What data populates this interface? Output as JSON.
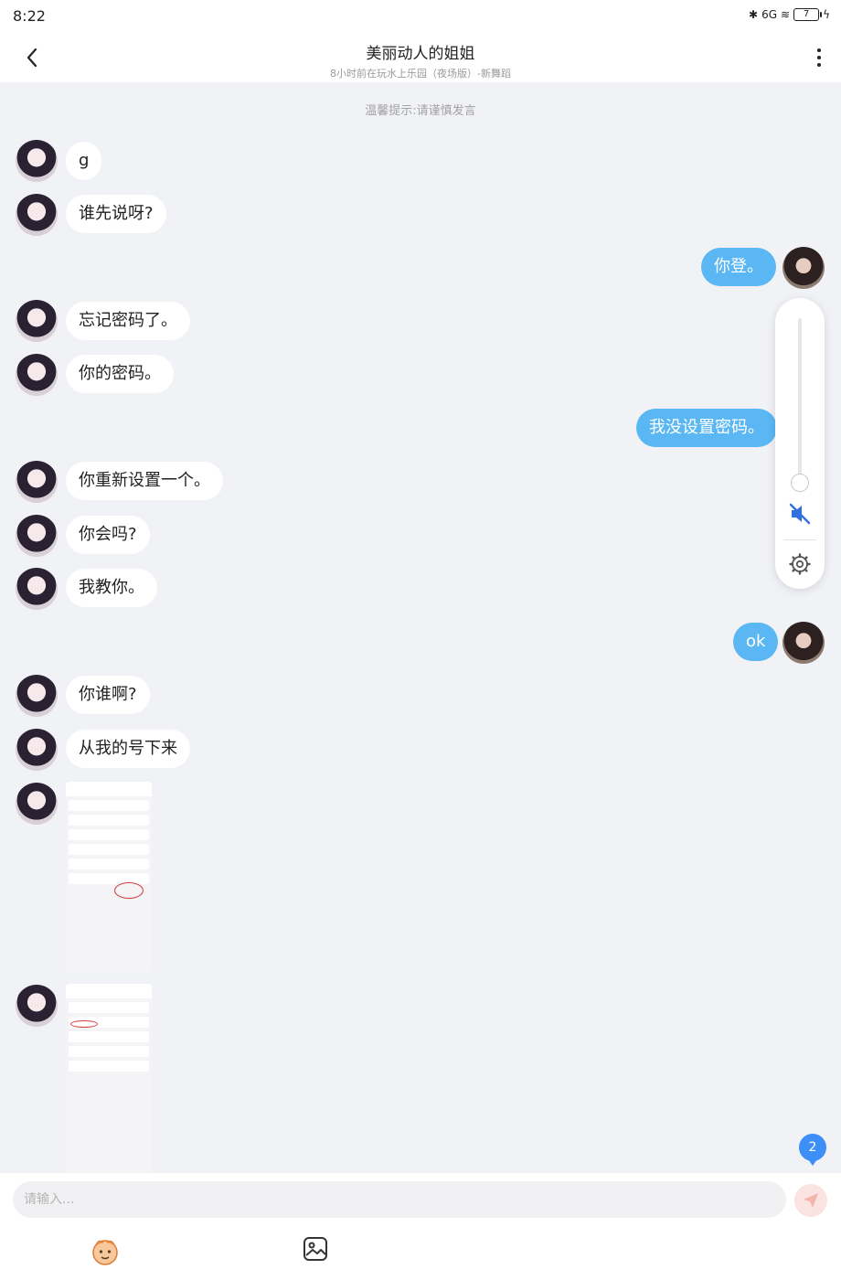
{
  "status_bar": {
    "time": "8:22",
    "signal": "6G",
    "battery": "7"
  },
  "header": {
    "title": "美丽动人的姐姐",
    "subtitle": "8小时前在玩水上乐园（夜场版）-新舞蹈"
  },
  "notice": "温馨提示:请谨慎发言",
  "messages": [
    {
      "side": "in",
      "text": "g"
    },
    {
      "side": "in",
      "text": "谁先说呀?"
    },
    {
      "side": "out",
      "text": "你登。"
    },
    {
      "side": "in",
      "text": "忘记密码了。"
    },
    {
      "side": "in",
      "text": "你的密码。"
    },
    {
      "side": "out",
      "text": "我没设置密码。"
    },
    {
      "side": "in",
      "text": "你重新设置一个。"
    },
    {
      "side": "in",
      "text": "你会吗?"
    },
    {
      "side": "in",
      "text": "我教你。"
    },
    {
      "side": "out",
      "text": "ok"
    },
    {
      "side": "in",
      "text": "你谁啊?"
    },
    {
      "side": "in",
      "text": "从我的号下来"
    }
  ],
  "unread_badge": "2",
  "composer": {
    "placeholder": "请输入..."
  },
  "colors": {
    "outgoing_bubble": "#5ab7f4",
    "badge": "#3d8ef7",
    "background": "#f1f2f6"
  },
  "icons": [
    "back-icon",
    "more-icon",
    "volume-mute-icon",
    "settings-gear-icon",
    "send-icon",
    "emoji-icon",
    "image-icon"
  ]
}
